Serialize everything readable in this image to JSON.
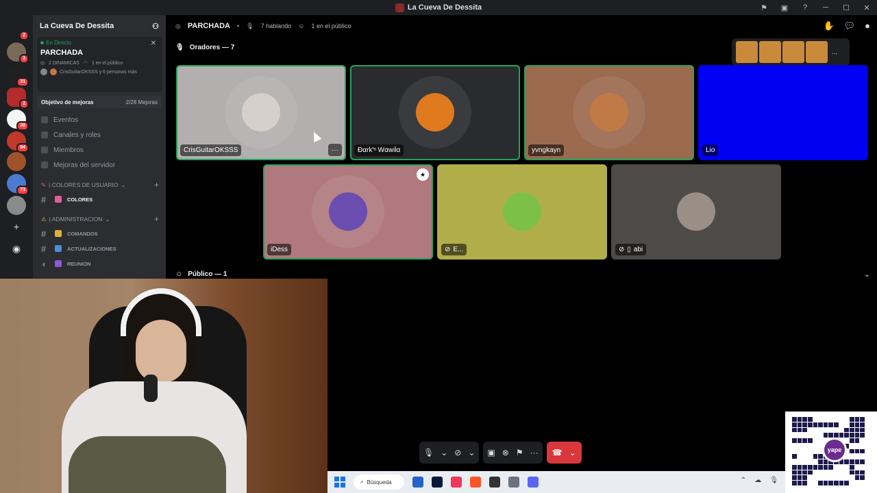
{
  "window": {
    "title": "La Cueva De Dessita"
  },
  "rail": {
    "servers": [
      {
        "badge": "2",
        "color": "#3a3a3a"
      },
      {
        "badge": "3",
        "color": "#7a6a58"
      },
      {
        "badge": "31",
        "color": "#202020"
      },
      {
        "badge": "2",
        "color": "#b52a2a"
      },
      {
        "badge": "30",
        "color": "#f4f4f4"
      },
      {
        "badge": "84",
        "color": "#c0392b"
      },
      {
        "badge": "",
        "color": "#a0522d"
      },
      {
        "badge": "73",
        "color": "#4a7bd0"
      },
      {
        "badge": "",
        "color": "#8a8a8a"
      }
    ]
  },
  "sidebar": {
    "server_name": "La Cueva De Dessita",
    "live": {
      "tag": "En Directo",
      "title": "PARCHADA",
      "meta_left": "2 DINAMICAS",
      "meta_right": "1 en el público",
      "speakers_line": "CrisGuitarOKSSS y 6 personas más"
    },
    "boost": {
      "label": "Objetivo de mejoras",
      "value": "2/28 Mejoras"
    },
    "nav": [
      "Eventos",
      "Canales y roles",
      "Miembros",
      "Mejoras del servidor"
    ],
    "categories": [
      {
        "name": "| COLORES DE USUARIO",
        "channels": [
          {
            "name": "COLORES",
            "color": "#e35d9c"
          }
        ]
      },
      {
        "name": "| ADMINISTRACION",
        "channels": [
          {
            "name": "COMANDOS",
            "color": "#e0b03a"
          },
          {
            "name": "ACTUALIZACIONES",
            "color": "#4a8fd6"
          },
          {
            "name": "REUNION",
            "color": "#8a5ad6"
          }
        ]
      }
    ]
  },
  "stage": {
    "name": "PARCHADA",
    "talking": "7 hablando",
    "audience": "1 en el público",
    "speakers_header": "Oradores — 7",
    "audience_header": "Público — 1",
    "emote_more": "...",
    "speakers": [
      {
        "name": "CrisGuitarOKSSS",
        "bg": "#b3afaf",
        "avatar": "#d7cfc9",
        "speaking": true,
        "more": "···"
      },
      {
        "name": "Ðαrk'ⁿ Wαwilα",
        "bg": "#2a2b2e",
        "avatar": "#e07a1f",
        "speaking": true
      },
      {
        "name": "yvngkayn",
        "bg": "#9b6a4f",
        "avatar": "#c07a46",
        "speaking": true
      },
      {
        "name": "Lio",
        "bg": "#0000f2",
        "avatar": "",
        "speaking": false
      },
      {
        "name": "iDess",
        "bg": "#b0797e",
        "avatar": "#6a4fb0",
        "speaking": true
      },
      {
        "name": "E...",
        "bg": "#b1ae4a",
        "avatar": "#7cc04a",
        "speaking": false
      },
      {
        "name": "abi",
        "bg": "#4d4a48",
        "avatar": "#9a8f86",
        "speaking": false
      }
    ]
  },
  "taskbar": {
    "search": "Búsqueda"
  },
  "qr": {
    "logo_text": "yape"
  }
}
